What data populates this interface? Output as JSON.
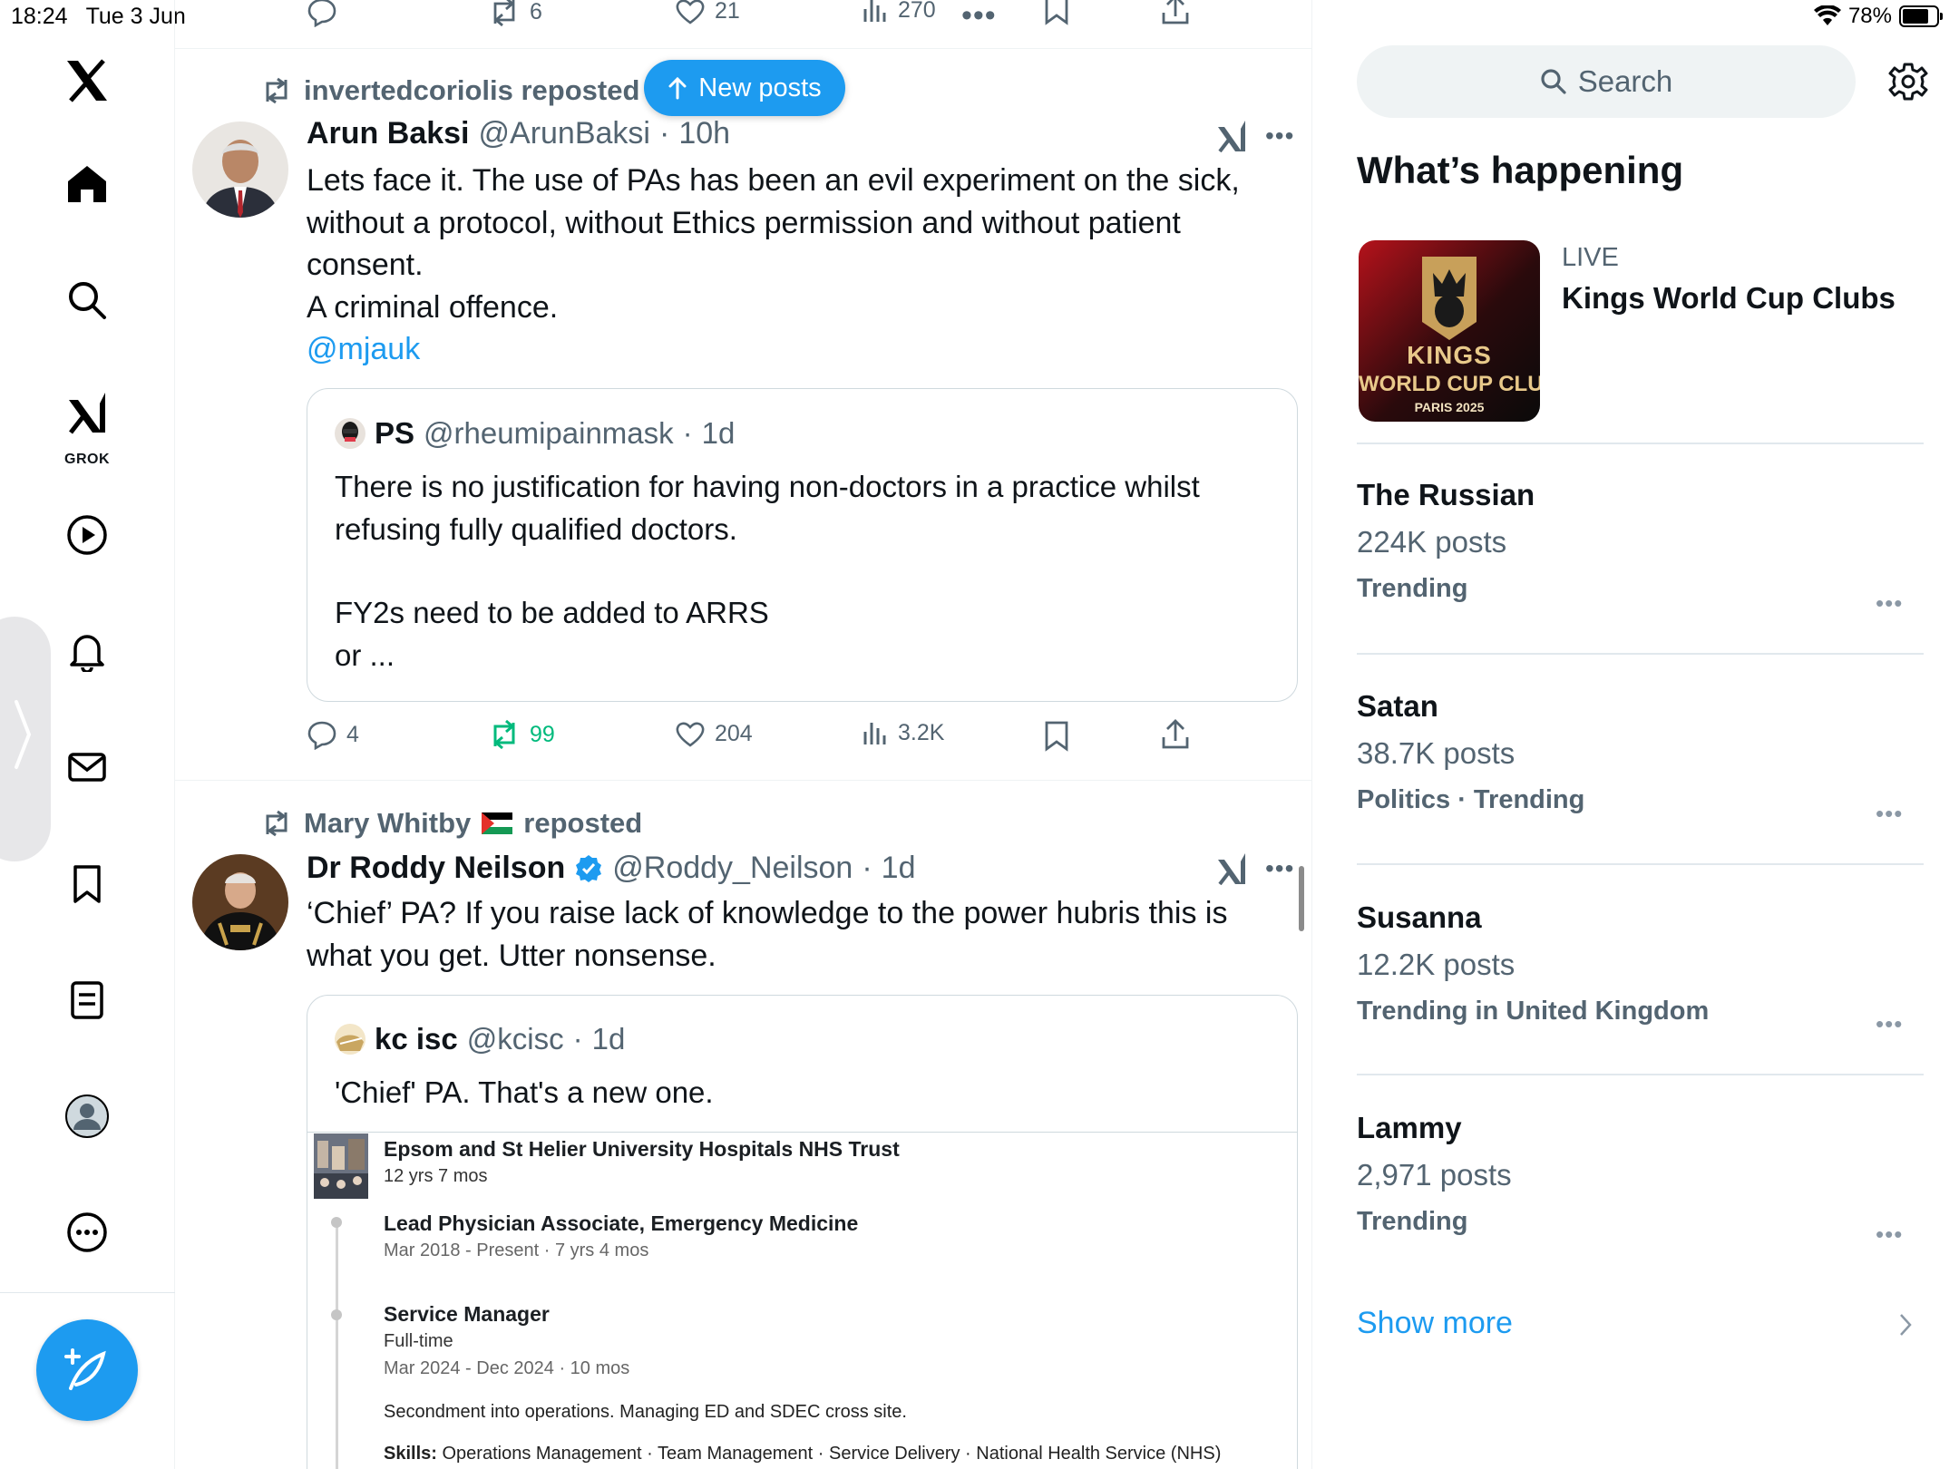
{
  "status_bar": {
    "time": "18:24",
    "date": "Tue 3 Jun",
    "battery": "78%",
    "battery_level": 0.78
  },
  "sidebar": {
    "items": [
      {
        "icon": "x-logo"
      },
      {
        "icon": "home-icon"
      },
      {
        "icon": "search-icon"
      },
      {
        "icon": "grok-icon",
        "label": "GROK"
      },
      {
        "icon": "video-icon"
      },
      {
        "icon": "notifications-icon"
      },
      {
        "icon": "messages-icon"
      },
      {
        "icon": "bookmarks-icon"
      },
      {
        "icon": "lists-icon"
      },
      {
        "icon": "profile-icon"
      },
      {
        "icon": "more-icon"
      }
    ]
  },
  "top_actions": {
    "replies": "",
    "reposts": "6",
    "likes": "21",
    "views": "270"
  },
  "new_posts_label": "New posts",
  "tweets": [
    {
      "reposted_by": "invertedcoriolis reposted",
      "name": "Arun Baksi",
      "handle": "@ArunBaksi",
      "time": "10h",
      "lines": [
        "Lets face it. The use of PAs has been an evil experiment on the sick,",
        "without a protocol, without Ethics permission and without patient",
        "consent.",
        "A criminal offence."
      ],
      "mention": "@mjauk",
      "quote": {
        "name": "PS",
        "handle": "@rheumipainmask",
        "time": "1d",
        "lines": [
          "There is no justification for having non-doctors in a practice whilst",
          "refusing fully qualified doctors.",
          "",
          "FY2s need to be added to ARRS",
          "or ..."
        ]
      },
      "actions": {
        "replies": "4",
        "reposts": "99",
        "likes": "204",
        "views": "3.2K"
      }
    },
    {
      "reposted_by_name": "Mary Whitby",
      "reposted_by_suffix": "reposted",
      "name": "Dr Roddy Neilson",
      "handle": "@Roddy_Neilson",
      "time": "1d",
      "lines": [
        "‘Chief’ PA? If you raise lack of knowledge to the power hubris this is",
        "what you get. Utter nonsense."
      ],
      "quote": {
        "name": "kc isc",
        "handle": "@kcisc",
        "time": "1d",
        "text": "'Chief' PA. That's a new one.",
        "card": {
          "org": "Epsom and St Helier University Hospitals NHS Trust",
          "duration": "12 yrs 7 mos",
          "role1_title": "Lead Physician Associate, Emergency Medicine",
          "role1_dates": "Mar 2018 - Present · 7 yrs 4 mos",
          "role2_title": "Service Manager",
          "role2_type": "Full-time",
          "role2_dates": "Mar 2024 - Dec 2024 · 10 mos",
          "role2_desc": "Secondment into operations. Managing ED and SDEC cross site.",
          "skills_label": "Skills:",
          "skills": "Operations Management · Team Management · Service Delivery · National Health Service (NHS)"
        }
      }
    }
  ],
  "right": {
    "search_placeholder": "Search",
    "title": "What’s happening",
    "live": {
      "label": "LIVE",
      "name": "Kings World Cup Clubs",
      "image_text_1": "KINGS",
      "image_text_2": "WORLD CUP CLUBS",
      "image_text_3": "PARIS 2025"
    },
    "trends": [
      {
        "name": "The Russian",
        "count": "224K posts",
        "meta": "Trending"
      },
      {
        "name": "Satan",
        "count": "38.7K posts",
        "meta": "Politics · Trending"
      },
      {
        "name": "Susanna",
        "count": "12.2K posts",
        "meta": "Trending in United Kingdom"
      },
      {
        "name": "Lammy",
        "count": "2,971 posts",
        "meta": "Trending"
      }
    ],
    "show_more": "Show more"
  },
  "colors": {
    "accent": "#1d9bf0",
    "repost_green": "#00ba7c",
    "muted": "#536471"
  }
}
